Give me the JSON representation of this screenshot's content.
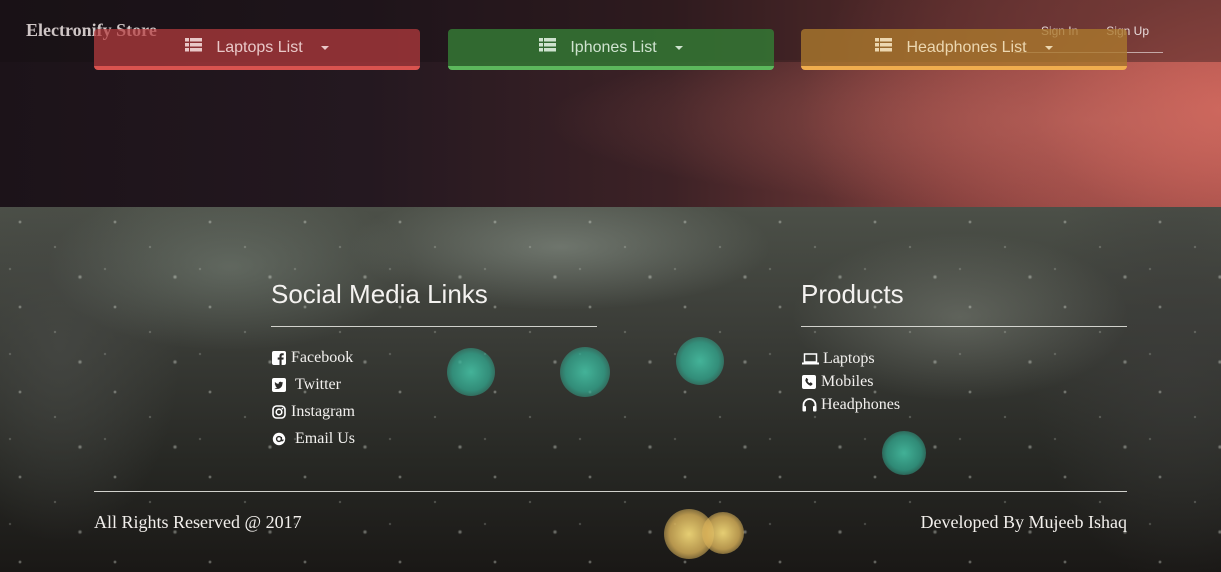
{
  "brand": "Electronify Store",
  "nav": {
    "sign_in": "Sign In",
    "sign_up": "Sign Up"
  },
  "categories": [
    {
      "label": "Laptops List",
      "icon": "list-icon",
      "color": "#d9534f"
    },
    {
      "label": "Iphones List",
      "icon": "list-icon",
      "color": "#5cb85c"
    },
    {
      "label": "Headphones List",
      "icon": "list-icon",
      "color": "#f0ad4e"
    }
  ],
  "footer": {
    "social": {
      "title": "Social Media Links",
      "links": [
        {
          "label": "Facebook",
          "icon": "facebook-icon"
        },
        {
          "label": "Twitter",
          "icon": "twitter-icon"
        },
        {
          "label": "Instagram",
          "icon": "instagram-icon"
        },
        {
          "label": "Email Us",
          "icon": "email-icon"
        }
      ]
    },
    "products": {
      "title": "Products",
      "links": [
        {
          "label": "Laptops",
          "icon": "laptop-icon"
        },
        {
          "label": "Mobiles",
          "icon": "phone-icon"
        },
        {
          "label": "Headphones",
          "icon": "headphones-icon"
        }
      ]
    },
    "copyright": "All Rights Reserved @ 2017",
    "developer": "Developed By Mujeeb Ishaq"
  }
}
